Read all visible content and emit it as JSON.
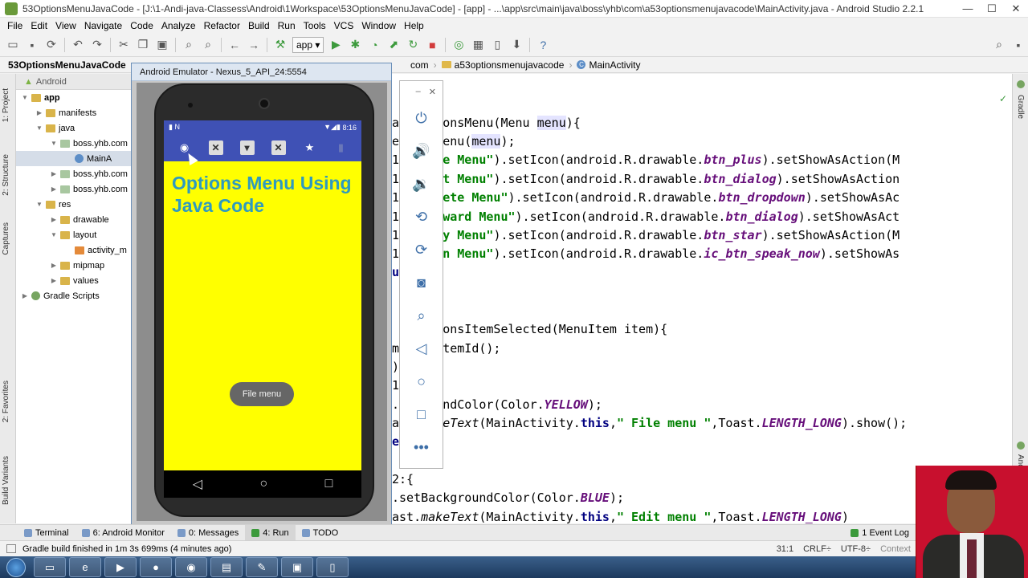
{
  "window": {
    "title": "53OptionsMenuJavaCode - [J:\\1-Andi-java-Classess\\Android\\1Workspace\\53OptionsMenuJavaCode] - [app] - ...\\app\\src\\main\\java\\boss\\yhb\\com\\a53optionsmenujavacode\\MainActivity.java - Android Studio 2.2.1"
  },
  "menubar": [
    "File",
    "Edit",
    "View",
    "Navigate",
    "Code",
    "Analyze",
    "Refactor",
    "Build",
    "Run",
    "Tools",
    "VCS",
    "Window",
    "Help"
  ],
  "toolbar": {
    "run_config": "app"
  },
  "breadcrumb": [
    {
      "label": "53OptionsMenuJavaCode",
      "icon": "folder-icon"
    },
    {
      "label": "com",
      "icon": "folder-icon"
    },
    {
      "label": "a53optionsmenujavacode",
      "icon": "folder-icon"
    },
    {
      "label": "MainActivity",
      "icon": "class-icon"
    }
  ],
  "side_tabs": {
    "left": [
      "1: Project",
      "2: Structure",
      "Captures",
      "2: Favorites",
      "Build Variants"
    ],
    "right": [
      "Gradle",
      "Android Model"
    ]
  },
  "project_panel": {
    "header": "Android",
    "tree": [
      {
        "label": "app",
        "depth": 0,
        "icon": "folder",
        "expanded": true,
        "bold": true
      },
      {
        "label": "manifests",
        "depth": 1,
        "icon": "folder",
        "expanded": false
      },
      {
        "label": "java",
        "depth": 1,
        "icon": "folder",
        "expanded": true
      },
      {
        "label": "boss.yhb.com",
        "depth": 2,
        "icon": "pkg",
        "expanded": true
      },
      {
        "label": "MainA",
        "depth": 3,
        "icon": "java",
        "selected": true
      },
      {
        "label": "boss.yhb.com",
        "depth": 2,
        "icon": "pkg",
        "expanded": false
      },
      {
        "label": "boss.yhb.com",
        "depth": 2,
        "icon": "pkg",
        "expanded": false
      },
      {
        "label": "res",
        "depth": 1,
        "icon": "folder",
        "expanded": true
      },
      {
        "label": "drawable",
        "depth": 2,
        "icon": "folder",
        "expanded": false,
        "leaf": true
      },
      {
        "label": "layout",
        "depth": 2,
        "icon": "folder",
        "expanded": true
      },
      {
        "label": "activity_m",
        "depth": 3,
        "icon": "xml"
      },
      {
        "label": "mipmap",
        "depth": 2,
        "icon": "folder",
        "expanded": false
      },
      {
        "label": "values",
        "depth": 2,
        "icon": "folder",
        "expanded": false
      },
      {
        "label": "Gradle Scripts",
        "depth": 0,
        "icon": "gradle",
        "expanded": false
      }
    ]
  },
  "editor": {
    "code_lines": [
      [
        {
          "t": "ateOptionsMenu(Menu "
        },
        {
          "t": "menu",
          "c": "var"
        },
        {
          "t": "){"
        }
      ],
      [
        {
          "t": "e"
        },
        {
          "t": "tionsMenu("
        },
        {
          "t": "menu",
          "c": "var"
        },
        {
          "t": ");"
        }
      ],
      [
        {
          "t": "1"
        },
        {
          "t": "1,"
        },
        {
          "t": "\"File Menu\"",
          "c": "str"
        },
        {
          "t": ").setIcon(android.R.drawable."
        },
        {
          "t": "btn_plus",
          "c": "fld"
        },
        {
          "t": ").setShowAsAction(M"
        }
      ],
      [
        {
          "t": "1"
        },
        {
          "t": "2,"
        },
        {
          "t": "\"Edit Menu\"",
          "c": "str"
        },
        {
          "t": ").setIcon(android.R.drawable."
        },
        {
          "t": "btn_dialog",
          "c": "fld"
        },
        {
          "t": ").setShowAsAction"
        }
      ],
      [
        {
          "t": "1"
        },
        {
          "t": "3,"
        },
        {
          "t": "\"Delete Menu\"",
          "c": "str"
        },
        {
          "t": ").setIcon(android.R.drawable."
        },
        {
          "t": "btn_dropdown",
          "c": "fld"
        },
        {
          "t": ").setShowAsAc"
        }
      ],
      [
        {
          "t": "1"
        },
        {
          "t": "4,"
        },
        {
          "t": "\"Forward Menu\"",
          "c": "str"
        },
        {
          "t": ").setIcon(android.R.drawable."
        },
        {
          "t": "btn_dialog",
          "c": "fld"
        },
        {
          "t": ").setShowAsAct"
        }
      ],
      [
        {
          "t": "1"
        },
        {
          "t": "5,"
        },
        {
          "t": "\"Copy Menu\"",
          "c": "str"
        },
        {
          "t": ").setIcon(android.R.drawable."
        },
        {
          "t": "btn_star",
          "c": "fld"
        },
        {
          "t": ").setShowAsAction(M"
        }
      ],
      [
        {
          "t": "1"
        },
        {
          "t": "6,"
        },
        {
          "t": "\"Open Menu\"",
          "c": "str"
        },
        {
          "t": ").setIcon(android.R.drawable."
        },
        {
          "t": "ic_btn_speak_now",
          "c": "fld"
        },
        {
          "t": ").setShowAs"
        }
      ],
      [
        {
          "t": "u",
          "c": "kw"
        }
      ],
      [],
      [],
      [
        {
          "t": "      "
        },
        {
          "t": "ionsItemSelected(MenuItem item){"
        }
      ],
      [
        {
          "t": "m"
        },
        {
          "t": "      "
        },
        {
          "t": "temId();"
        }
      ],
      [
        {
          "t": ")"
        }
      ],
      [
        {
          "t": "1"
        }
      ],
      [
        {
          "t": "."
        },
        {
          "t": "ckgroundColor(Color."
        },
        {
          "t": "YELLOW",
          "c": "fld"
        },
        {
          "t": ");"
        }
      ],
      [
        {
          "t": "a"
        },
        {
          "t": "     "
        },
        {
          "t": "keText",
          "c": "ital"
        },
        {
          "t": "(MainActivity."
        },
        {
          "t": "this",
          "c": "kw"
        },
        {
          "t": ","
        },
        {
          "t": "\" File menu \"",
          "c": "str"
        },
        {
          "t": ",Toast."
        },
        {
          "t": "LENGTH_LONG",
          "c": "fld"
        },
        {
          "t": ").show();"
        }
      ],
      [
        {
          "t": "e",
          "c": "kw"
        }
      ],
      [],
      [
        {
          "t": "2:{"
        }
      ],
      [
        {
          "t": ".setBackgroundColor(Color."
        },
        {
          "t": "BLUE",
          "c": "fld"
        },
        {
          "t": ");"
        }
      ],
      [
        {
          "t": "ast."
        },
        {
          "t": "makeText",
          "c": "ital"
        },
        {
          "t": "(MainActivity."
        },
        {
          "t": "this",
          "c": "kw"
        },
        {
          "t": ","
        },
        {
          "t": "\" Edit menu \"",
          "c": "str"
        },
        {
          "t": ",Toast."
        },
        {
          "t": "LENGTH_LONG",
          "c": "fld"
        },
        {
          "t": ")"
        }
      ]
    ]
  },
  "emulator": {
    "window_title": "Android Emulator - Nexus_5_API_24:5554",
    "clock": "8:16",
    "app_title": "Options Menu Using Java Code",
    "toast": "File menu",
    "action_icons": [
      "circle-icon",
      "close-box-icon",
      "dropdown-box-icon",
      "close-box-icon",
      "star-icon",
      "mic-icon"
    ],
    "side_controls": [
      "power-icon",
      "volume-up-icon",
      "volume-down-icon",
      "rotate-left-icon",
      "rotate-right-icon",
      "camera-icon",
      "zoom-icon",
      "back-icon",
      "home-icon",
      "overview-icon",
      "more-icon"
    ]
  },
  "bottom_tabs": [
    {
      "label": "Terminal",
      "icon": "terminal-icon"
    },
    {
      "label": "6: Android Monitor",
      "icon": "android-icon"
    },
    {
      "label": "0: Messages",
      "icon": "messages-icon"
    },
    {
      "label": "4: Run",
      "icon": "run-icon",
      "active": true
    },
    {
      "label": "TODO",
      "icon": "todo-icon"
    },
    {
      "label": "1 Event Log",
      "icon": "event-log-icon"
    }
  ],
  "status": {
    "message": "Gradle build finished in 1m 3s 699ms (4 minutes ago)",
    "position": "31:1",
    "line_sep": "CRLF÷",
    "encoding": "UTF-8÷",
    "context": "Context"
  },
  "colors": {
    "app_bar": "#3f51b5",
    "app_background": "#ffff00",
    "app_title": "#2e9abf",
    "webcam_background": "#c8102e"
  }
}
